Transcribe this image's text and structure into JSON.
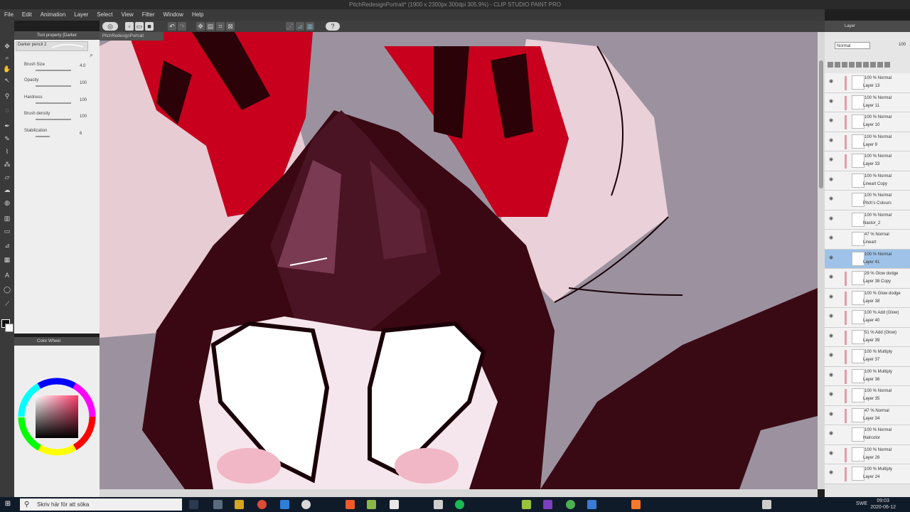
{
  "window": {
    "title": "PitchRedesignPortrait* (1900 x 2300px 300dpi 305.9%) - CLIP STUDIO PAINT PRO"
  },
  "menu": [
    "File",
    "Edit",
    "Animation",
    "Layer",
    "Select",
    "View",
    "Filter",
    "Window",
    "Help"
  ],
  "tool_property": {
    "panel_title": "Tool property [Darker",
    "brush_name": "Darker pencil 2",
    "props": [
      {
        "label": "Brush Size",
        "value": "4.0"
      },
      {
        "label": "Opacity",
        "value": "100"
      },
      {
        "label": "Hardness",
        "value": "100"
      },
      {
        "label": "Brush density",
        "value": "100"
      },
      {
        "label": "Stabilization",
        "value": "6"
      }
    ]
  },
  "color_panel": {
    "title": "Color Wheel"
  },
  "canvas": {
    "tab_label": "PitchRedesignPortrait"
  },
  "layer_panel": {
    "title": "Layer",
    "blend_mode": "Normal",
    "opacity": "100",
    "layers": [
      {
        "mode": "100 % Normal",
        "name": "Layer 13",
        "selected": false,
        "clipped": true
      },
      {
        "mode": "100 % Normal",
        "name": "Layer 11",
        "selected": false,
        "clipped": true
      },
      {
        "mode": "100 % Normal",
        "name": "Layer 10",
        "selected": false,
        "clipped": true
      },
      {
        "mode": "100 % Normal",
        "name": "Layer 9",
        "selected": false,
        "clipped": true
      },
      {
        "mode": "100 % Normal",
        "name": "Layer 33",
        "selected": false,
        "clipped": true
      },
      {
        "mode": "100 % Normal",
        "name": "Lineart Copy",
        "selected": false,
        "clipped": false
      },
      {
        "mode": "100 % Normal",
        "name": "Pitch's Colours",
        "selected": false,
        "clipped": false
      },
      {
        "mode": "100 % Normal",
        "name": "Nastor_2",
        "selected": false,
        "clipped": false
      },
      {
        "mode": "47 % Normal",
        "name": "Lineart",
        "selected": false,
        "clipped": false
      },
      {
        "mode": "100 % Normal",
        "name": "Layer 41",
        "selected": true,
        "clipped": false
      },
      {
        "mode": "29 % Glow dodge",
        "name": "Layer 38 Copy",
        "selected": false,
        "clipped": true
      },
      {
        "mode": "100 % Glow dodge",
        "name": "Layer 38",
        "selected": false,
        "clipped": true
      },
      {
        "mode": "100 % Add (Glow)",
        "name": "Layer 40",
        "selected": false,
        "clipped": true
      },
      {
        "mode": "51 % Add (Glow)",
        "name": "Layer 39",
        "selected": false,
        "clipped": true
      },
      {
        "mode": "100 % Multiply",
        "name": "Layer 37",
        "selected": false,
        "clipped": true
      },
      {
        "mode": "100 % Multiply",
        "name": "Layer 36",
        "selected": false,
        "clipped": true
      },
      {
        "mode": "100 % Normal",
        "name": "Layer 35",
        "selected": false,
        "clipped": true
      },
      {
        "mode": "47 % Normal",
        "name": "Layer 34",
        "selected": false,
        "clipped": true
      },
      {
        "mode": "100 % Normal",
        "name": "Haircolor",
        "selected": false,
        "clipped": false
      },
      {
        "mode": "100 % Normal",
        "name": "Layer 26",
        "selected": false,
        "clipped": true
      },
      {
        "mode": "100 % Multiply",
        "name": "Layer 24",
        "selected": false,
        "clipped": true
      }
    ]
  },
  "taskbar": {
    "search_placeholder": "Skriv här för att söka",
    "lang": "SWE",
    "time": "09:03",
    "date": "2020-06-12"
  }
}
